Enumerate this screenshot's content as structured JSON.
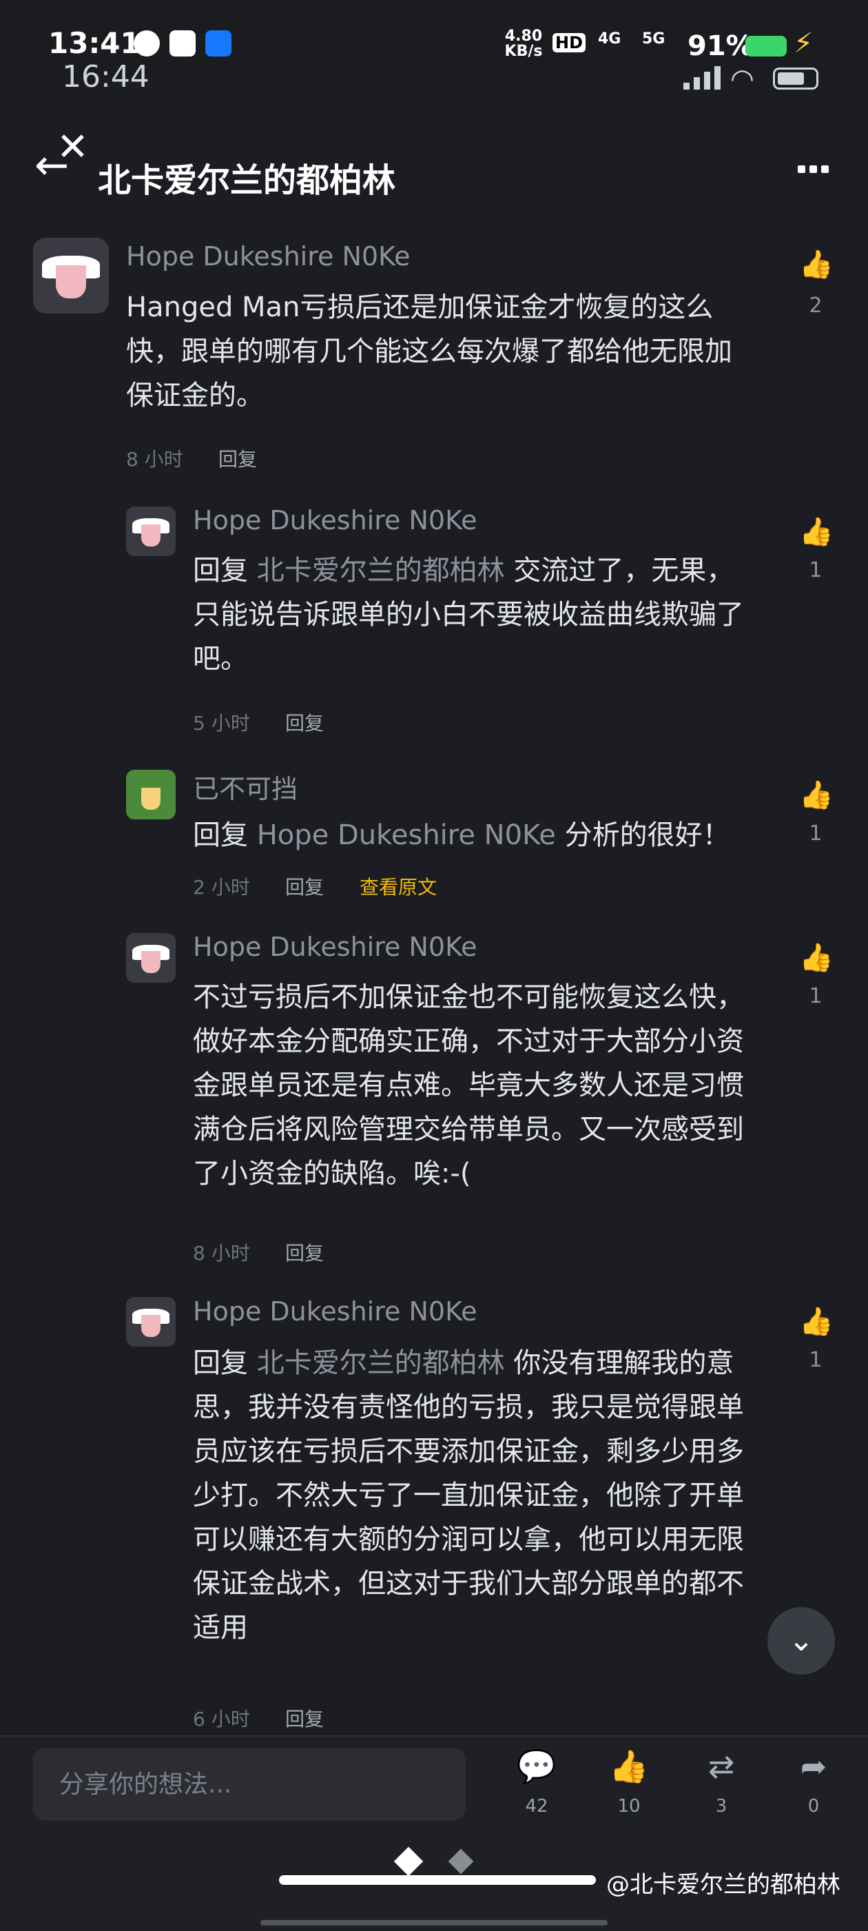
{
  "system_status": {
    "time": "13:41",
    "net_speed": "4.80\nKB/s",
    "hd": "HD",
    "net_4g": "4G",
    "net_5g": "5G",
    "battery": "91%"
  },
  "inner_status": {
    "time": "16:44"
  },
  "header": {
    "title": "北卡爱尔兰的都柏林"
  },
  "comments": [
    {
      "author": "Hope Dukeshire N0Ke",
      "text": "Hanged Man亏损后还是加保证金才恢复的这么\n快，跟单的哪有几个能这么每次爆了都给他无限加\n保证金的。",
      "time": "8 小时",
      "reply_label": "回复",
      "likes": "2"
    },
    {
      "author": "Hope Dukeshire N0Ke",
      "reply_prefix": "回复 ",
      "reply_to": "北卡爱尔兰的都柏林",
      "text_first": " 交流过了，无果，",
      "text": "只能说告诉跟单的小白不要被收益曲线欺骗了\n吧。",
      "time": "5 小时",
      "reply_label": "回复",
      "likes": "1"
    },
    {
      "author": "已不可挡",
      "reply_prefix": "回复 ",
      "reply_to": "Hope Dukeshire N0Ke",
      "text_first": " 分析的很好！",
      "time": "2 小时",
      "reply_label": "回复",
      "translate": "查看原文",
      "likes": "1"
    },
    {
      "author": "Hope Dukeshire N0Ke",
      "text": "不过亏损后不加保证金也不可能恢复这么快，\n做好本金分配确实正确，不过对于大部分小资\n金跟单员还是有点难。毕竟大多数人还是习惯\n满仓后将风险管理交给带单员。又一次感受到\n了小资金的缺陷。唉:-(",
      "time": "8 小时",
      "reply_label": "回复",
      "likes": "1"
    },
    {
      "author": "Hope Dukeshire N0Ke",
      "reply_prefix": "回复 ",
      "reply_to": "北卡爱尔兰的都柏林",
      "text_first": " 你没有理解我的意",
      "text": "思，我并没有责怪他的亏损，我只是觉得跟单\n员应该在亏损后不要添加保证金，剩多少用多\n少打。不然大亏了一直加保证金，他除了开单\n可以赚还有大额的分润可以拿，他可以用无限\n保证金战术，但这对于我们大部分跟单的都不\n适用",
      "time": "6 小时",
      "reply_label": "回复",
      "likes": "1"
    }
  ],
  "footer": {
    "input_placeholder": "分享你的想法...",
    "comments_count": "42",
    "likes_count": "10",
    "reposts_count": "3",
    "shares_count": "0"
  },
  "watermark": "@北卡爱尔兰的都柏林",
  "colors": {
    "background": "#1c1d22",
    "accent": "#f0b90b"
  }
}
